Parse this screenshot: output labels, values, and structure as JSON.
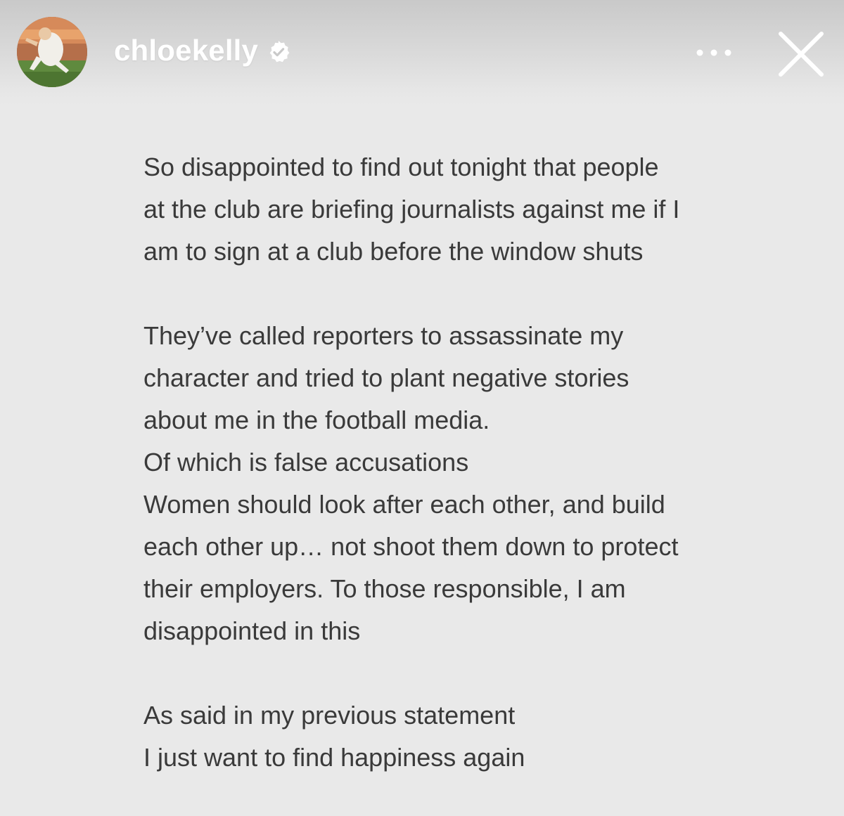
{
  "header": {
    "username": "chloekelly",
    "avatar_icon": "profile-photo-icon",
    "verified_icon": "verified-badge-icon",
    "more_icon": "more-options-icon",
    "close_icon": "close-icon"
  },
  "story": {
    "paragraphs": [
      [
        "So disappointed to find out tonight that people",
        "at the club are briefing journalists against me if I",
        "am to sign at a club before the window shuts"
      ],
      [
        "They’ve called reporters to assassinate my",
        "character and tried to plant negative stories",
        "about me in the football media.",
        "Of which is false accusations",
        "Women should look after each other, and build",
        "each other up… not shoot them down to protect",
        "their employers. To those responsible, I am",
        "disappointed in this"
      ],
      [
        "As said in my previous statement",
        "I just want to find happiness again"
      ]
    ]
  },
  "colors": {
    "background": "#e9e9e9",
    "text": "#3a3a3a",
    "header_text": "#ffffff"
  }
}
